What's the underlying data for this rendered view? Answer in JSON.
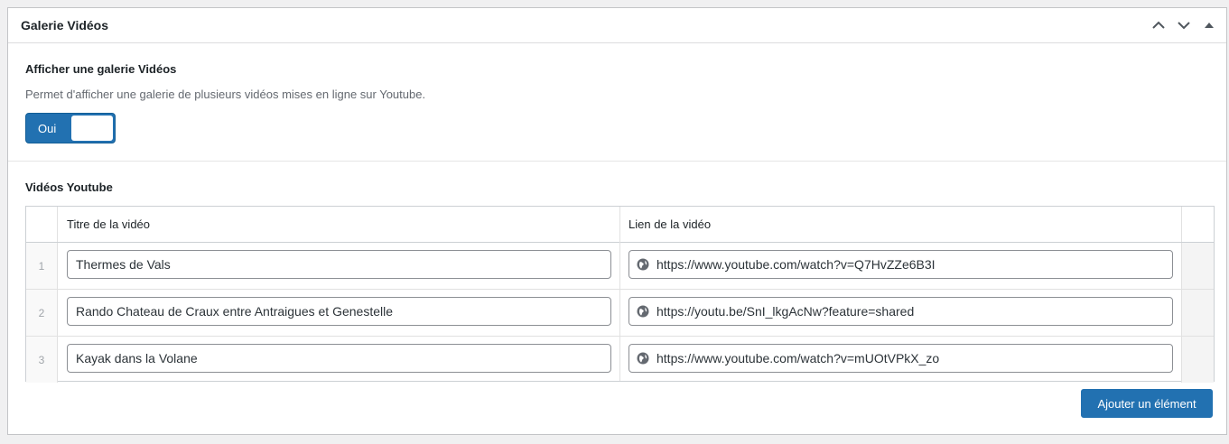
{
  "panel": {
    "title": "Galerie Vidéos",
    "actions": [
      "move-up-icon",
      "move-down-icon",
      "toggle-panel-icon"
    ]
  },
  "gallery_field": {
    "label": "Afficher une galerie Vidéos",
    "description": "Permet d'afficher une galerie de plusieurs vidéos mises en ligne sur Youtube.",
    "toggle": {
      "label": "Oui",
      "checked": true
    }
  },
  "videos_field": {
    "label": "Vidéos Youtube",
    "columns": [
      "Titre de la vidéo",
      "Lien de la vidéo"
    ],
    "rows": [
      {
        "num": "1",
        "title": "Thermes de Vals",
        "link": "https://www.youtube.com/watch?v=Q7HvZZe6B3I"
      },
      {
        "num": "2",
        "title": "Rando Chateau de Craux entre Antraigues et Genestelle",
        "link": "https://youtu.be/SnI_lkgAcNw?feature=shared"
      },
      {
        "num": "3",
        "title": "Kayak dans la Volane",
        "link": "https://www.youtube.com/watch?v=mUOtVPkX_zo"
      }
    ],
    "add_button": "Ajouter un élément"
  },
  "colors": {
    "accent": "#2271b1",
    "border": "#c3c4c7"
  }
}
